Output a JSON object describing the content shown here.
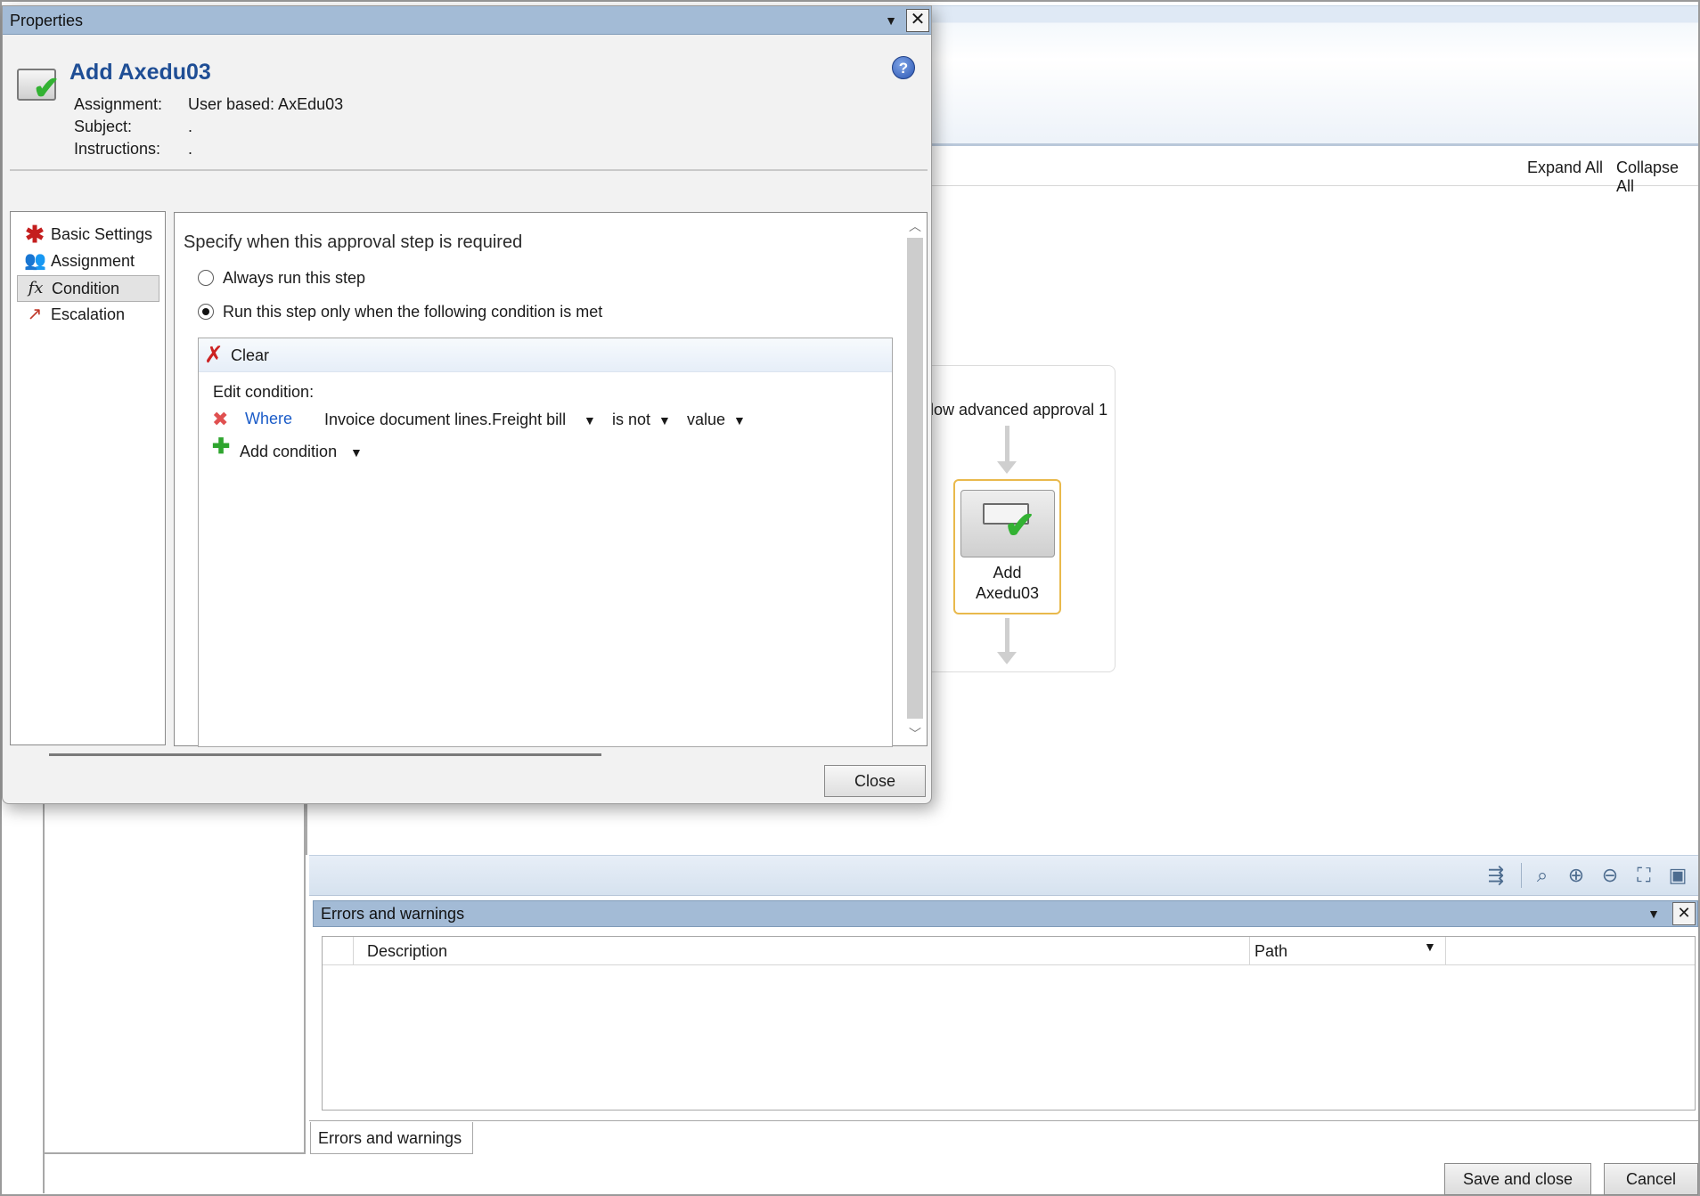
{
  "background": {
    "links": {
      "expand_all": "Expand All",
      "collapse_all": "Collapse All"
    },
    "flow": {
      "label": "low advanced approval 1",
      "node_label_line1": "Add",
      "node_label_line2": "Axedu03"
    },
    "toolbar_icons": [
      "pan-icon",
      "zoom-rectangle-icon",
      "zoom-in-icon",
      "zoom-out-icon",
      "fit-to-window-icon",
      "actual-size-icon"
    ],
    "errors_panel": {
      "title": "Errors and warnings",
      "columns": {
        "description": "Description",
        "path": "Path"
      },
      "tab_label": "Errors and warnings"
    },
    "buttons": {
      "save_and_close": "Save and close",
      "cancel": "Cancel"
    }
  },
  "dialog": {
    "title": "Properties",
    "heading": "Add Axedu03",
    "meta": {
      "assignment_label": "Assignment:",
      "assignment_value": "User based: AxEdu03",
      "subject_label": "Subject:",
      "subject_value": ".",
      "instructions_label": "Instructions:",
      "instructions_value": "."
    },
    "nav": [
      {
        "label": "Basic Settings",
        "icon": "asterisk-icon"
      },
      {
        "label": "Assignment",
        "icon": "users-icon"
      },
      {
        "label": "Condition",
        "icon": "function-icon",
        "selected": true
      },
      {
        "label": "Escalation",
        "icon": "escalation-icon"
      }
    ],
    "condition": {
      "title": "Specify when this approval step is required",
      "option_always": "Always run this step",
      "option_conditional": "Run this step only when the following condition is met",
      "selected_option": "conditional",
      "clear_label": "Clear",
      "edit_label": "Edit condition:",
      "where_label": "Where",
      "field": "Invoice document lines.Freight bill",
      "operator": "is not",
      "value": "value",
      "add_condition_label": "Add condition"
    },
    "close_label": "Close"
  }
}
